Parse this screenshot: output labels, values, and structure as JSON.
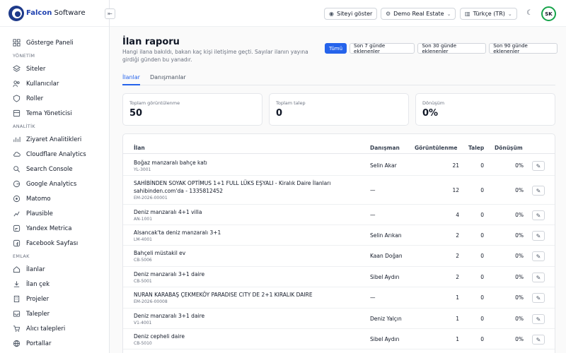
{
  "brand": {
    "strong": "Falcon",
    "rest": " Software"
  },
  "topbar": {
    "site_btn": "Siteyi göster",
    "org_select": "Demo Real Estate",
    "lang_select": "Türkçe (TR)",
    "avatar": "SK"
  },
  "sidebar": {
    "dashboard": "Gösterge Paneli",
    "sections": [
      {
        "title": "YÖNETİM",
        "items": [
          {
            "label": "Siteler",
            "icon": "layers-icon"
          },
          {
            "label": "Kullanıcılar",
            "icon": "users-icon"
          },
          {
            "label": "Roller",
            "icon": "shield-icon"
          },
          {
            "label": "Tema Yöneticisi",
            "icon": "palette-icon"
          }
        ]
      },
      {
        "title": "ANALİTİK",
        "items": [
          {
            "label": "Ziyaret Analitikleri",
            "icon": "chart-icon"
          },
          {
            "label": "Cloudflare Analytics",
            "icon": "cloud-icon"
          },
          {
            "label": "Search Console",
            "icon": "search-icon"
          },
          {
            "label": "Google Analytics",
            "icon": "google-icon"
          },
          {
            "label": "Matomo",
            "icon": "matomo-icon"
          },
          {
            "label": "Plausible",
            "icon": "plausible-icon"
          },
          {
            "label": "Yandex Metrica",
            "icon": "yandex-icon"
          },
          {
            "label": "Facebook Sayfası",
            "icon": "facebook-icon"
          }
        ]
      },
      {
        "title": "EMLAK",
        "items": [
          {
            "label": "İlanlar",
            "icon": "home-icon"
          },
          {
            "label": "İlan çek",
            "icon": "import-icon"
          },
          {
            "label": "Projeler",
            "icon": "building-icon"
          },
          {
            "label": "Talepler",
            "icon": "inbox-icon"
          },
          {
            "label": "Alıcı talepleri",
            "icon": "cart-icon"
          },
          {
            "label": "Portallar",
            "icon": "globe-icon"
          }
        ]
      }
    ]
  },
  "page": {
    "title": "İlan raporu",
    "description": "Hangi ilana bakıldı, bakan kaç kişi iletişime geçti. Sayılar ilanın yayına girdiği günden bu yanadır.",
    "filters": [
      "Tümü",
      "Son 7 günde eklenenler",
      "Son 30 günde eklenenler",
      "Son 90 günde eklenenler"
    ],
    "tabs": [
      "İlanlar",
      "Danışmanlar"
    ]
  },
  "stats": [
    {
      "label": "Toplam görüntülenme",
      "value": "50"
    },
    {
      "label": "Toplam talep",
      "value": "0"
    },
    {
      "label": "Dönüşüm",
      "value": "0%"
    }
  ],
  "table": {
    "headers": {
      "listing": "İlan",
      "agent": "Danışman",
      "views": "Görüntülenme",
      "requests": "Talep",
      "conversion": "Dönüşüm"
    },
    "rows": [
      {
        "title": "Boğaz manzaralı bahçe katı",
        "code": "YL-3001",
        "agent": "Selin Akar",
        "views": "21",
        "requests": "0",
        "conversion": "0%"
      },
      {
        "title": "SAHİBİNDEN SOYAK OPTİMUS 1+1 FULL LÜKS EŞYALI - Kiralık Daire İlanları sahibinden.com'da - 1335812452",
        "code": "EM-2026-00001",
        "agent": "—",
        "views": "12",
        "requests": "0",
        "conversion": "0%"
      },
      {
        "title": "Deniz manzaralı 4+1 villa",
        "code": "AN-1001",
        "agent": "—",
        "views": "4",
        "requests": "0",
        "conversion": "0%"
      },
      {
        "title": "Alsancak'ta deniz manzaralı 3+1",
        "code": "LM-4001",
        "agent": "Selin Arıkan",
        "views": "2",
        "requests": "0",
        "conversion": "0%"
      },
      {
        "title": "Bahçeli müstakil ev",
        "code": "CB-5006",
        "agent": "Kaan Doğan",
        "views": "2",
        "requests": "0",
        "conversion": "0%"
      },
      {
        "title": "Deniz manzaralı 3+1 daire",
        "code": "CB-5001",
        "agent": "Sibel Aydın",
        "views": "2",
        "requests": "0",
        "conversion": "0%"
      },
      {
        "title": "NURAN KARABAŞ ÇEKMEKÖY PARADISE CITY DE 2+1 KIRALIK DAIRE",
        "code": "EM-2026-00008",
        "agent": "—",
        "views": "1",
        "requests": "0",
        "conversion": "0%"
      },
      {
        "title": "Deniz manzaralı 3+1 daire",
        "code": "V1-4001",
        "agent": "Deniz Yalçın",
        "views": "1",
        "requests": "0",
        "conversion": "0%"
      },
      {
        "title": "Deniz cepheli daire",
        "code": "CB-5010",
        "agent": "Sibel Aydın",
        "views": "1",
        "requests": "0",
        "conversion": "0%"
      }
    ]
  },
  "colors": {
    "accent": "#2563eb",
    "avatar_ring": "#16a34a"
  }
}
